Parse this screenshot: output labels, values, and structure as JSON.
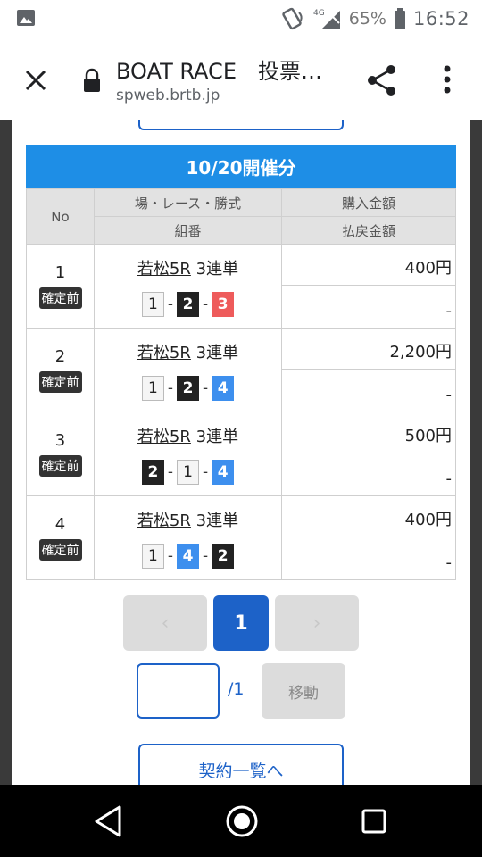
{
  "status": {
    "network": "4G",
    "battery": "65%",
    "time": "16:52"
  },
  "browser": {
    "title": "BOAT RACE　投票…",
    "host": "spweb.brtb.jp"
  },
  "header": {
    "date_label": "10/20開催分"
  },
  "columns": {
    "no": "No",
    "race_type": "場・レース・勝式",
    "combination": "組番",
    "purchase": "購入金額",
    "payout": "払戻金額"
  },
  "rows": [
    {
      "no": "1",
      "status": "確定前",
      "venue": "若松5R",
      "bet_type": "3連単",
      "boats": [
        "1",
        "2",
        "3"
      ],
      "amount": "400円",
      "payout": "-"
    },
    {
      "no": "2",
      "status": "確定前",
      "venue": "若松5R",
      "bet_type": "3連単",
      "boats": [
        "1",
        "2",
        "4"
      ],
      "amount": "2,200円",
      "payout": "-"
    },
    {
      "no": "3",
      "status": "確定前",
      "venue": "若松5R",
      "bet_type": "3連単",
      "boats": [
        "2",
        "1",
        "4"
      ],
      "amount": "500円",
      "payout": "-"
    },
    {
      "no": "4",
      "status": "確定前",
      "venue": "若松5R",
      "bet_type": "3連単",
      "boats": [
        "1",
        "4",
        "2"
      ],
      "amount": "400円",
      "payout": "-"
    }
  ],
  "pager": {
    "prev": "‹",
    "current": "1",
    "next": "›"
  },
  "jump": {
    "total": "/1",
    "button": "移動"
  },
  "list_button": "契約一覧へ",
  "separator": "-"
}
